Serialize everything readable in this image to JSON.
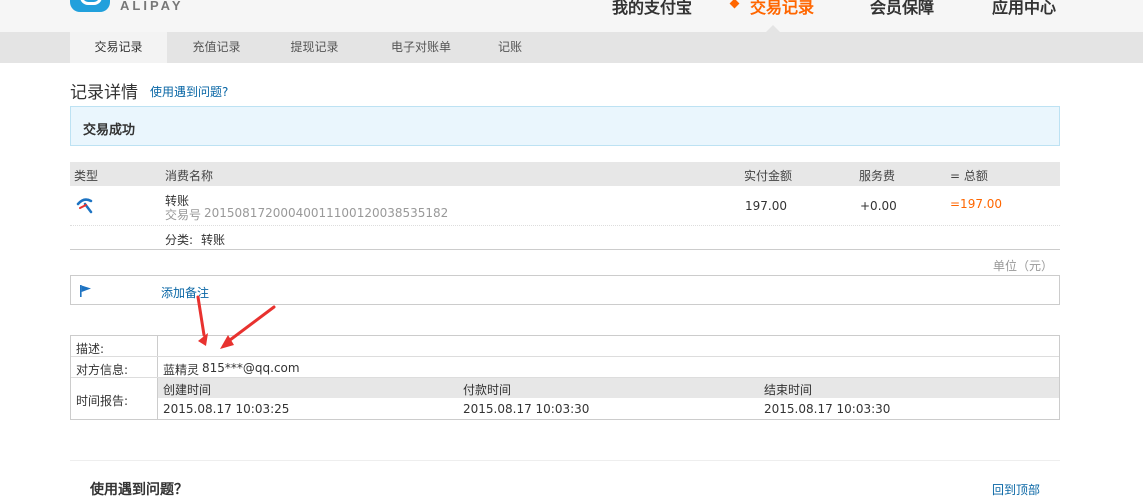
{
  "header": {
    "logo_text": "ALIPAY",
    "nav": [
      {
        "label": "我的支付宝"
      },
      {
        "label": "交易记录",
        "active": true
      },
      {
        "label": "会员保障"
      },
      {
        "label": "应用中心"
      }
    ]
  },
  "subnav": [
    {
      "label": "交易记录",
      "active": true
    },
    {
      "label": "充值记录"
    },
    {
      "label": "提现记录"
    },
    {
      "label": "电子对账单"
    },
    {
      "label": "记账"
    }
  ],
  "page": {
    "title": "记录详情",
    "help_link": "使用遇到问题?"
  },
  "status": {
    "text": "交易成功"
  },
  "table": {
    "headers": [
      "类型",
      "消费名称",
      "实付金额",
      "服务费",
      "= 总额"
    ],
    "row": {
      "type_icon": "transfer-icon",
      "name": "转账",
      "trade_no_label": "交易号",
      "trade_no": "20150817200040011100120038535182",
      "paid": "197.00",
      "fee": "+0.00",
      "total": "=197.00",
      "category_label": "分类:",
      "category": "转账"
    },
    "unit": "单位（元）"
  },
  "note": {
    "link": "添加备注",
    "icon": "flag-icon"
  },
  "details": {
    "desc_label": "描述:",
    "desc_value": "",
    "party_label": "对方信息:",
    "party_name": "蓝精灵",
    "party_account": "815***@qq.com",
    "time_label": "时间报告:",
    "time_headers": [
      "创建时间",
      "付款时间",
      "结束时间"
    ],
    "time_values": [
      "2015.08.17 10:03:25",
      "2015.08.17 10:03:30",
      "2015.08.17 10:03:30"
    ]
  },
  "footer": {
    "title": "使用遇到问题？",
    "back_to_top": "回到顶部"
  },
  "colors": {
    "accent": "#ff6600",
    "link": "#0866a5",
    "arrow": "#e8322f"
  }
}
